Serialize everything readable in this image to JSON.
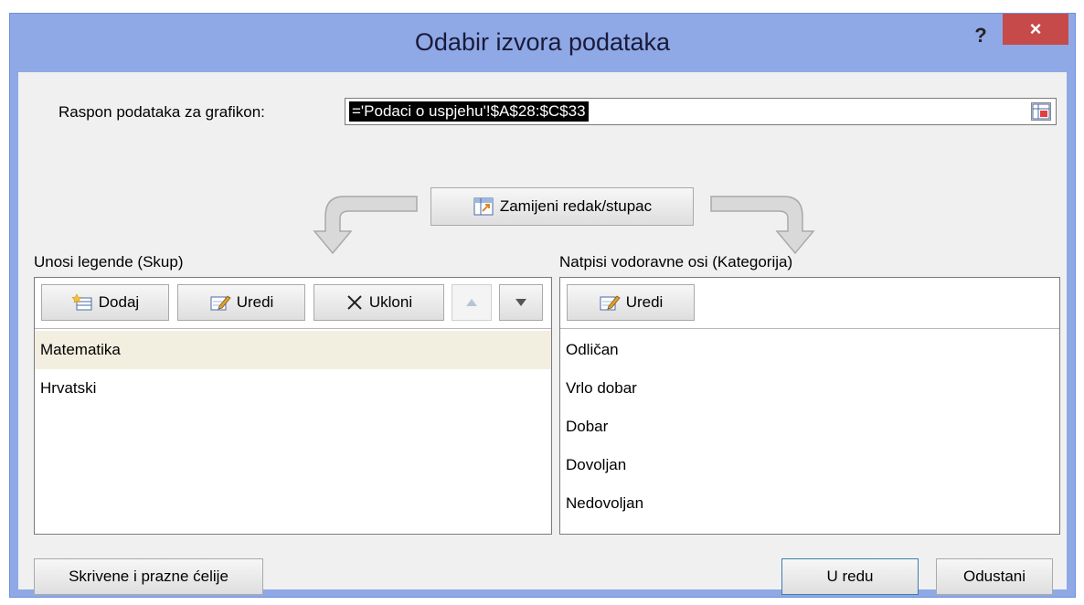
{
  "window": {
    "title": "Odabir izvora podataka",
    "help_label": "?",
    "close_label": "×"
  },
  "range": {
    "label": "Raspon podataka za grafikon:",
    "value": "='Podaci o uspjehu'!$A$28:$C$33"
  },
  "switch_button": {
    "label": "Zamijeni redak/stupac"
  },
  "legend": {
    "heading": "Unosi legende (Skup)",
    "add_label": "Dodaj",
    "edit_label": "Uredi",
    "remove_label": "Ukloni",
    "items": [
      "Matematika",
      "Hrvatski"
    ],
    "selected_index": 0
  },
  "axis": {
    "heading": "Natpisi vodoravne osi (Kategorija)",
    "edit_label": "Uredi",
    "items": [
      "Odličan",
      "Vrlo dobar",
      "Dobar",
      "Dovoljan",
      "Nedovoljan"
    ]
  },
  "footer": {
    "hidden_cells_label": "Skrivene i prazne ćelije",
    "ok_label": "U redu",
    "cancel_label": "Odustani"
  },
  "colors": {
    "frame": "#8fa9e6",
    "close": "#c74a4a",
    "selected_row": "#f2efe0"
  }
}
